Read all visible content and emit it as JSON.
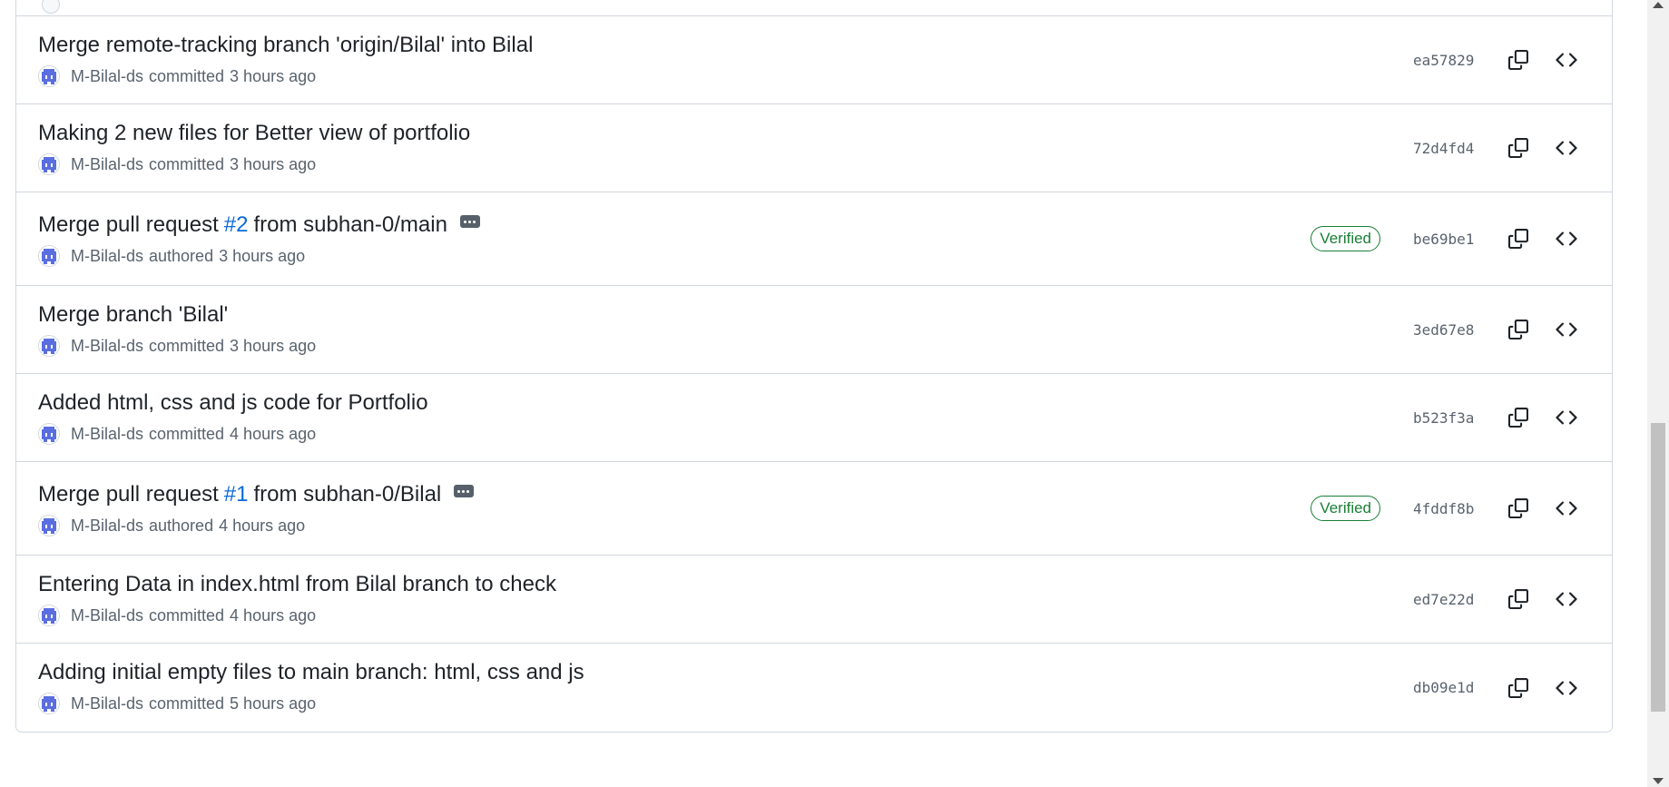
{
  "commits": [
    {
      "title_parts": [
        "Merge remote-tracking branch 'origin/Bilal' into Bilal"
      ],
      "pr_number": "",
      "title_suffix": "",
      "author": "M-Bilal-ds",
      "action": "committed",
      "time": "3 hours ago",
      "verified": "",
      "sha": "ea57829"
    },
    {
      "title_parts": [
        "Making 2 new files for Better view of portfolio"
      ],
      "pr_number": "",
      "title_suffix": "",
      "author": "M-Bilal-ds",
      "action": "committed",
      "time": "3 hours ago",
      "verified": "",
      "sha": "72d4fd4"
    },
    {
      "title_parts": [
        "Merge pull request"
      ],
      "pr_number": "#2",
      "title_suffix": "from subhan-0/main",
      "author": "M-Bilal-ds",
      "action": "authored",
      "time": "3 hours ago",
      "verified": "Verified",
      "sha": "be69be1"
    },
    {
      "title_parts": [
        "Merge branch 'Bilal'"
      ],
      "pr_number": "",
      "title_suffix": "",
      "author": "M-Bilal-ds",
      "action": "committed",
      "time": "3 hours ago",
      "verified": "",
      "sha": "3ed67e8"
    },
    {
      "title_parts": [
        "Added html, css and js code for Portfolio"
      ],
      "pr_number": "",
      "title_suffix": "",
      "author": "M-Bilal-ds",
      "action": "committed",
      "time": "4 hours ago",
      "verified": "",
      "sha": "b523f3a"
    },
    {
      "title_parts": [
        "Merge pull request"
      ],
      "pr_number": "#1",
      "title_suffix": "from subhan-0/Bilal",
      "author": "M-Bilal-ds",
      "action": "authored",
      "time": "4 hours ago",
      "verified": "Verified",
      "sha": "4fddf8b"
    },
    {
      "title_parts": [
        "Entering Data in index.html from Bilal branch to check"
      ],
      "pr_number": "",
      "title_suffix": "",
      "author": "M-Bilal-ds",
      "action": "committed",
      "time": "4 hours ago",
      "verified": "",
      "sha": "ed7e22d"
    },
    {
      "title_parts": [
        "Adding initial empty files to main branch: html, css and js"
      ],
      "pr_number": "",
      "title_suffix": "",
      "author": "M-Bilal-ds",
      "action": "committed",
      "time": "5 hours ago",
      "verified": "",
      "sha": "db09e1d"
    }
  ],
  "icons": {
    "copy": "copy-icon",
    "browse": "code-icon",
    "ellipsis": "kebab-horizontal-icon",
    "avatar": "identicon"
  },
  "colors": {
    "link": "#0969da",
    "verified": "#1a7f37",
    "muted": "#59636e",
    "border": "#d0d7de",
    "avatar": "#5a6ee0"
  }
}
